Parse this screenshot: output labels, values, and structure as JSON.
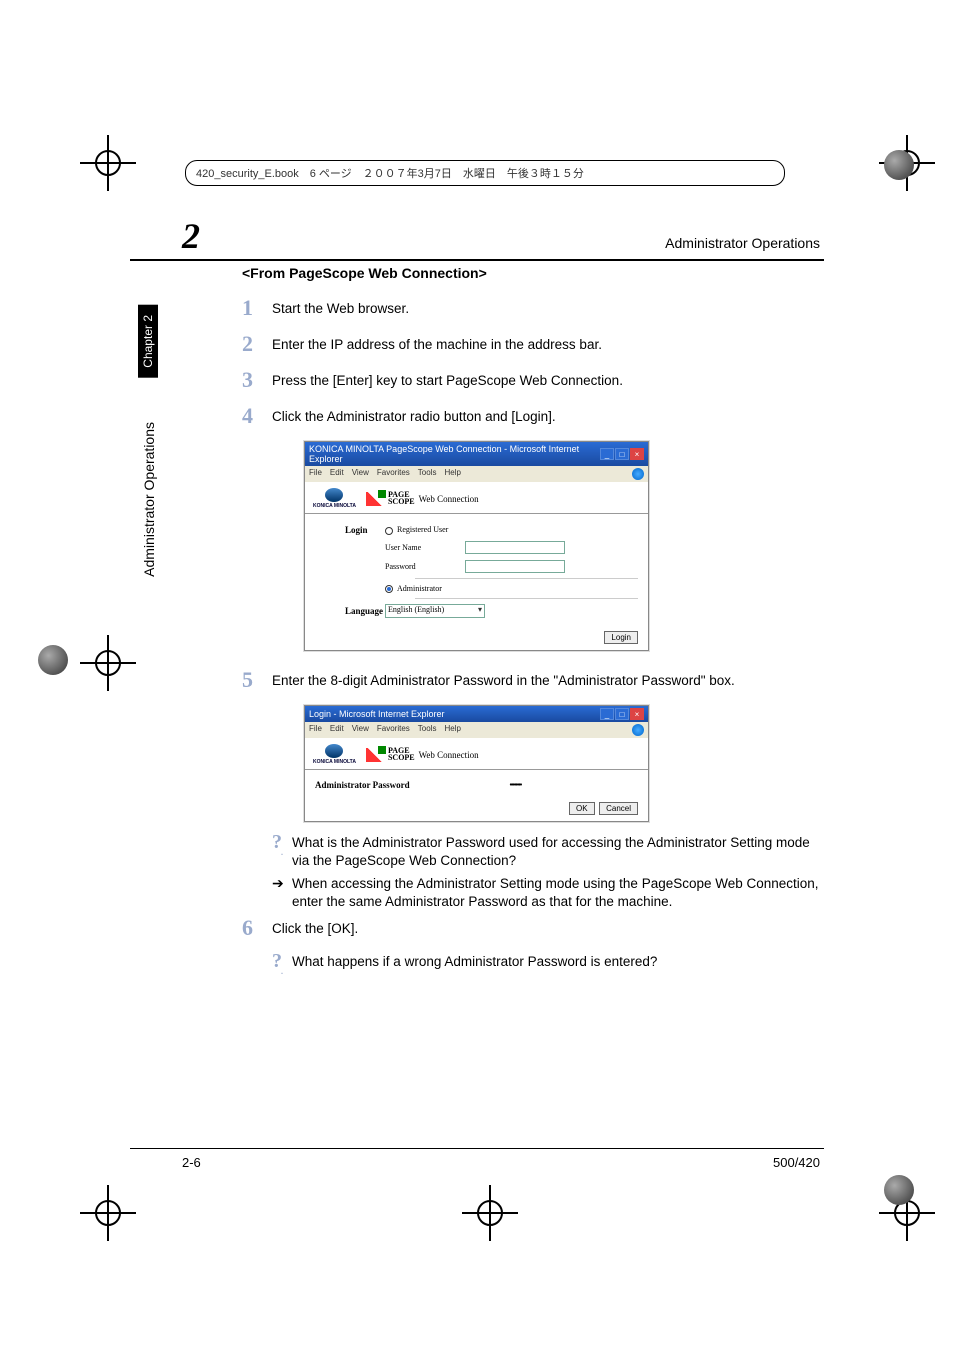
{
  "file_header": "420_security_E.book　6 ページ　２００７年3月7日　水曜日　午後３時１５分",
  "chapter_num": "2",
  "header_title": "Administrator Operations",
  "sidebar": {
    "chapter": "Chapter 2",
    "label": "Administrator Operations"
  },
  "subheading": "<From PageScope Web Connection>",
  "steps": {
    "s1": {
      "n": "1",
      "t": "Start the Web browser."
    },
    "s2": {
      "n": "2",
      "t": "Enter the IP address of the machine in the address bar."
    },
    "s3": {
      "n": "3",
      "t": "Press the [Enter] key to start PageScope Web Connection."
    },
    "s4": {
      "n": "4",
      "t": "Click the Administrator radio button and [Login]."
    },
    "s5": {
      "n": "5",
      "t": "Enter the 8-digit Administrator Password in the \"Administrator Password\" box."
    },
    "s6": {
      "n": "6",
      "t": "Click the [OK]."
    }
  },
  "qa": {
    "q1": "What is the Administrator Password used for accessing the Administrator Setting mode via the PageScope Web Connection?",
    "a1": "When accessing the Administrator Setting mode using the PageScope Web Connection, enter the same Administrator Password as that for the machine.",
    "q2": "What happens if a wrong Administrator Password is entered?"
  },
  "screenshot1": {
    "title": "KONICA MINOLTA PageScope Web Connection - Microsoft Internet Explorer",
    "menu": {
      "file": "File",
      "edit": "Edit",
      "view": "View",
      "fav": "Favorites",
      "tools": "Tools",
      "help": "Help"
    },
    "brand": {
      "km": "KONICA MINOLTA",
      "ps1": "PAGE",
      "ps2": "SCOPE",
      "wc": "Web Connection"
    },
    "rows": {
      "login": "Login",
      "reguser": "Registered User",
      "username": "User Name",
      "password": "Password",
      "admin": "Administrator",
      "language": "Language",
      "langval": "English (English)"
    },
    "login_btn": "Login"
  },
  "screenshot2": {
    "title": "Login - Microsoft Internet Explorer",
    "admin_pw_label": "Administrator Password",
    "pw_value": "••••••••",
    "ok": "OK",
    "cancel": "Cancel"
  },
  "footer": {
    "left": "2-6",
    "right": "500/420"
  }
}
